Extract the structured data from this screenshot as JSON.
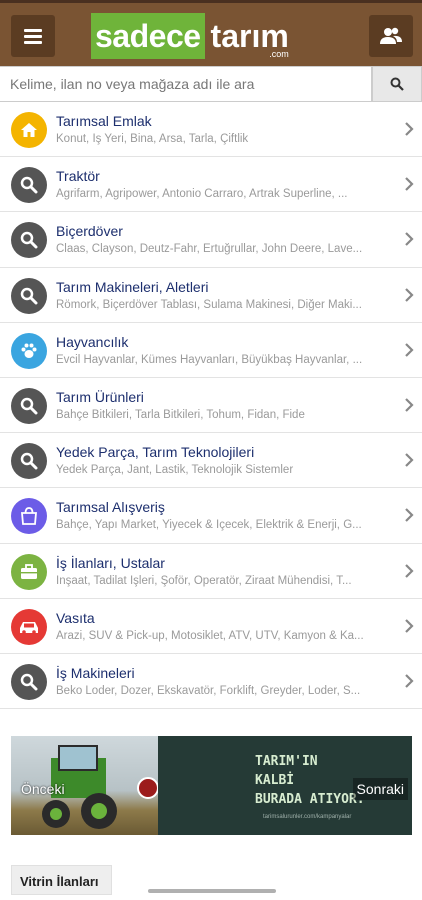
{
  "header": {
    "logo_part1": "sadece",
    "logo_part2": "tarım",
    "logo_suffix": ".com"
  },
  "search": {
    "placeholder": "Kelime, ilan no veya mağaza adı ile ara"
  },
  "categories": [
    {
      "title": "Tarımsal Emlak",
      "subtitle": "Konut, İş Yeri, Bina, Arsa, Tarla, Çiftlik",
      "icon": "home-icon",
      "color": "#f4b400"
    },
    {
      "title": "Traktör",
      "subtitle": "Agrifarm, Agripower, Antonio Carraro, Artrak Superline, ...",
      "icon": "search-icon",
      "color": "#555555"
    },
    {
      "title": "Biçerdöver",
      "subtitle": "Claas, Clayson, Deutz-Fahr, Ertuğrullar, John Deere, Lave...",
      "icon": "search-icon",
      "color": "#555555"
    },
    {
      "title": "Tarım Makineleri, Aletleri",
      "subtitle": "Römork, Biçerdöver Tablası, Sulama Makinesi, Diğer Maki...",
      "icon": "search-icon",
      "color": "#555555"
    },
    {
      "title": "Hayvancılık",
      "subtitle": "Evcil Hayvanlar, Kümes Hayvanları, Büyükbaş Hayvanlar, ...",
      "icon": "paw-icon",
      "color": "#3aa5e0"
    },
    {
      "title": "Tarım Ürünleri",
      "subtitle": "Bahçe Bitkileri, Tarla Bitkileri, Tohum, Fidan, Fide",
      "icon": "search-icon",
      "color": "#555555"
    },
    {
      "title": "Yedek Parça, Tarım Teknolojileri",
      "subtitle": "Yedek Parça, Jant, Lastik, Teknolojik Sistemler",
      "icon": "search-icon",
      "color": "#555555"
    },
    {
      "title": "Tarımsal Alışveriş",
      "subtitle": "Bahçe, Yapı Market, Yiyecek & İçecek, Elektrik & Enerji, G...",
      "icon": "shopping-bag-icon",
      "color": "#6c5ce7"
    },
    {
      "title": "İş İlanları, Ustalar",
      "subtitle": "İnşaat, Tadilat İşleri, Şoför, Operatör, Ziraat Mühendisi, T...",
      "icon": "briefcase-icon",
      "color": "#7cb342"
    },
    {
      "title": "Vasıta",
      "subtitle": "Arazi, SUV & Pick-up, Motosiklet, ATV, UTV, Kamyon & Ka...",
      "icon": "car-icon",
      "color": "#e53935"
    },
    {
      "title": "İş Makineleri",
      "subtitle": "Beko Loder, Dozer, Ekskavatör, Forklift, Greyder, Loder, S...",
      "icon": "search-icon",
      "color": "#555555"
    }
  ],
  "banner": {
    "prev_label": "Önceki",
    "next_label": "Sonraki",
    "headline_1": "TARIM'IN",
    "headline_2": "KALBİ",
    "headline_3": "BURADA ATIYOR.",
    "small_text": "tarimsalurunler.com/kampanyalar"
  },
  "vitrin": {
    "label": "Vitrin İlanları"
  }
}
